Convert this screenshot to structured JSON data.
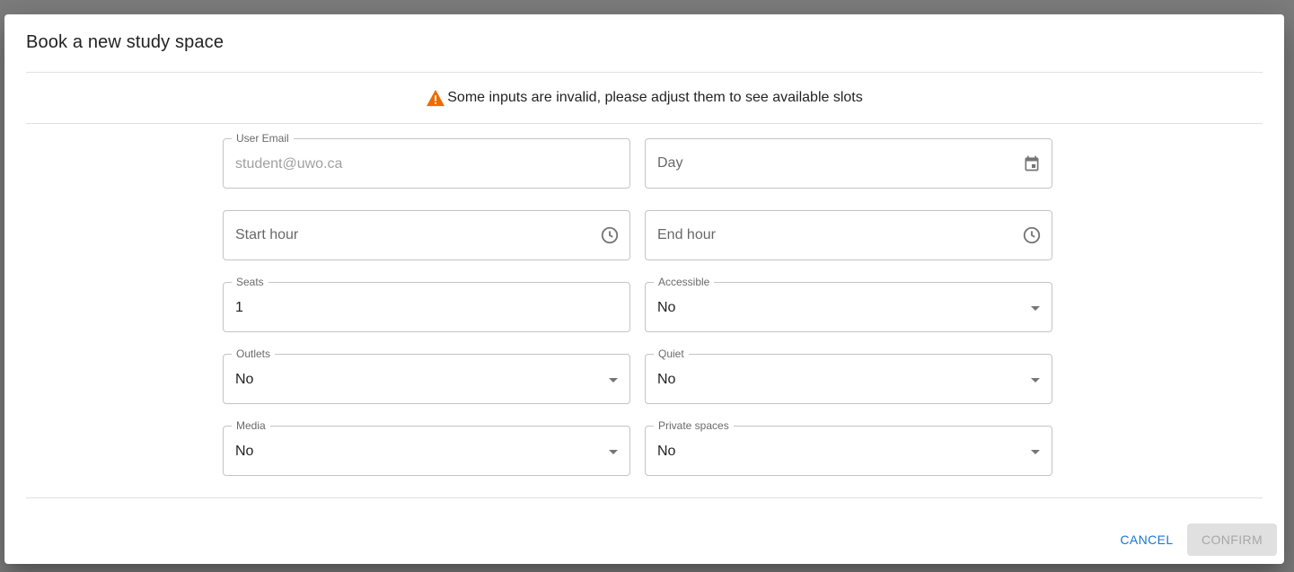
{
  "dialog": {
    "title": "Book a new study space",
    "warning": "Some inputs are invalid, please adjust them to see available slots",
    "warning_color": "#ed6c02"
  },
  "fields": {
    "user_email": {
      "label": "User Email",
      "value": "student@uwo.ca",
      "icon": "none"
    },
    "day": {
      "placeholder": "Day",
      "icon": "calendar-icon"
    },
    "start_hour": {
      "placeholder": "Start hour",
      "icon": "clock-icon"
    },
    "end_hour": {
      "placeholder": "End hour",
      "icon": "clock-icon"
    },
    "seats": {
      "label": "Seats",
      "value": "1"
    },
    "accessible": {
      "label": "Accessible",
      "value": "No"
    },
    "outlets": {
      "label": "Outlets",
      "value": "No"
    },
    "quiet": {
      "label": "Quiet",
      "value": "No"
    },
    "media": {
      "label": "Media",
      "value": "No"
    },
    "private_spaces": {
      "label": "Private spaces",
      "value": "No"
    }
  },
  "actions": {
    "cancel_label": "CANCEL",
    "confirm_label": "CONFIRM",
    "accent_color": "#1976d2"
  }
}
